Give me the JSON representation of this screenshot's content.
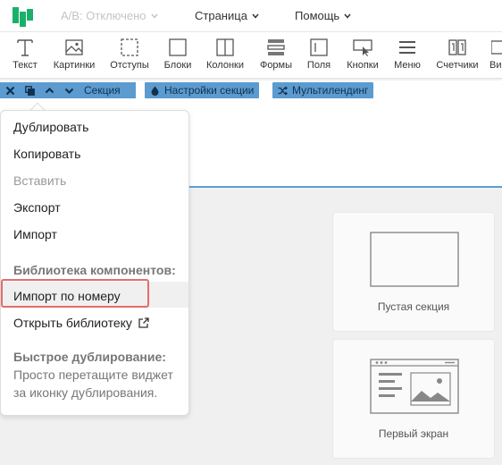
{
  "topbar": {
    "ab_label": "A/B: Отключено",
    "page_label": "Страница",
    "help_label": "Помощь",
    "colors": {
      "logo": "#1ab06b",
      "ab_dim": "#c4c4c4"
    }
  },
  "toolbar": {
    "items": [
      {
        "label": "Текст",
        "icon": "text-icon"
      },
      {
        "label": "Картинки",
        "icon": "image-icon"
      },
      {
        "label": "Отступы",
        "icon": "padding-icon"
      },
      {
        "label": "Блоки",
        "icon": "block-icon"
      },
      {
        "label": "Колонки",
        "icon": "columns-icon"
      },
      {
        "label": "Формы",
        "icon": "form-icon"
      },
      {
        "label": "Поля",
        "icon": "field-icon"
      },
      {
        "label": "Кнопки",
        "icon": "button-icon"
      },
      {
        "label": "Меню",
        "icon": "menu-icon"
      },
      {
        "label": "Счетчики",
        "icon": "counter-icon"
      },
      {
        "label": "Ви",
        "icon": "video-icon"
      }
    ]
  },
  "section_bar": {
    "section_label": "Секция",
    "settings_label": "Настройки секции",
    "multilanding_label": "Мультилендинг",
    "accent": "#5b9bd0"
  },
  "context_menu": {
    "duplicate": "Дублировать",
    "copy": "Копировать",
    "paste": "Вставить",
    "export": "Экспорт",
    "import": "Импорт",
    "library_heading": "Библиотека компонентов:",
    "import_by_number": "Импорт по номеру",
    "open_library": "Открыть библиотеку",
    "quick_dup_heading": "Быстрое дублирование:",
    "quick_dup_note_1": "Просто перетащите виджет",
    "quick_dup_note_2": "за иконку дублирования.",
    "highlight_color": "#e36d6d"
  },
  "templates": {
    "empty_section": "Пустая секция",
    "first_screen": "Первый экран"
  }
}
